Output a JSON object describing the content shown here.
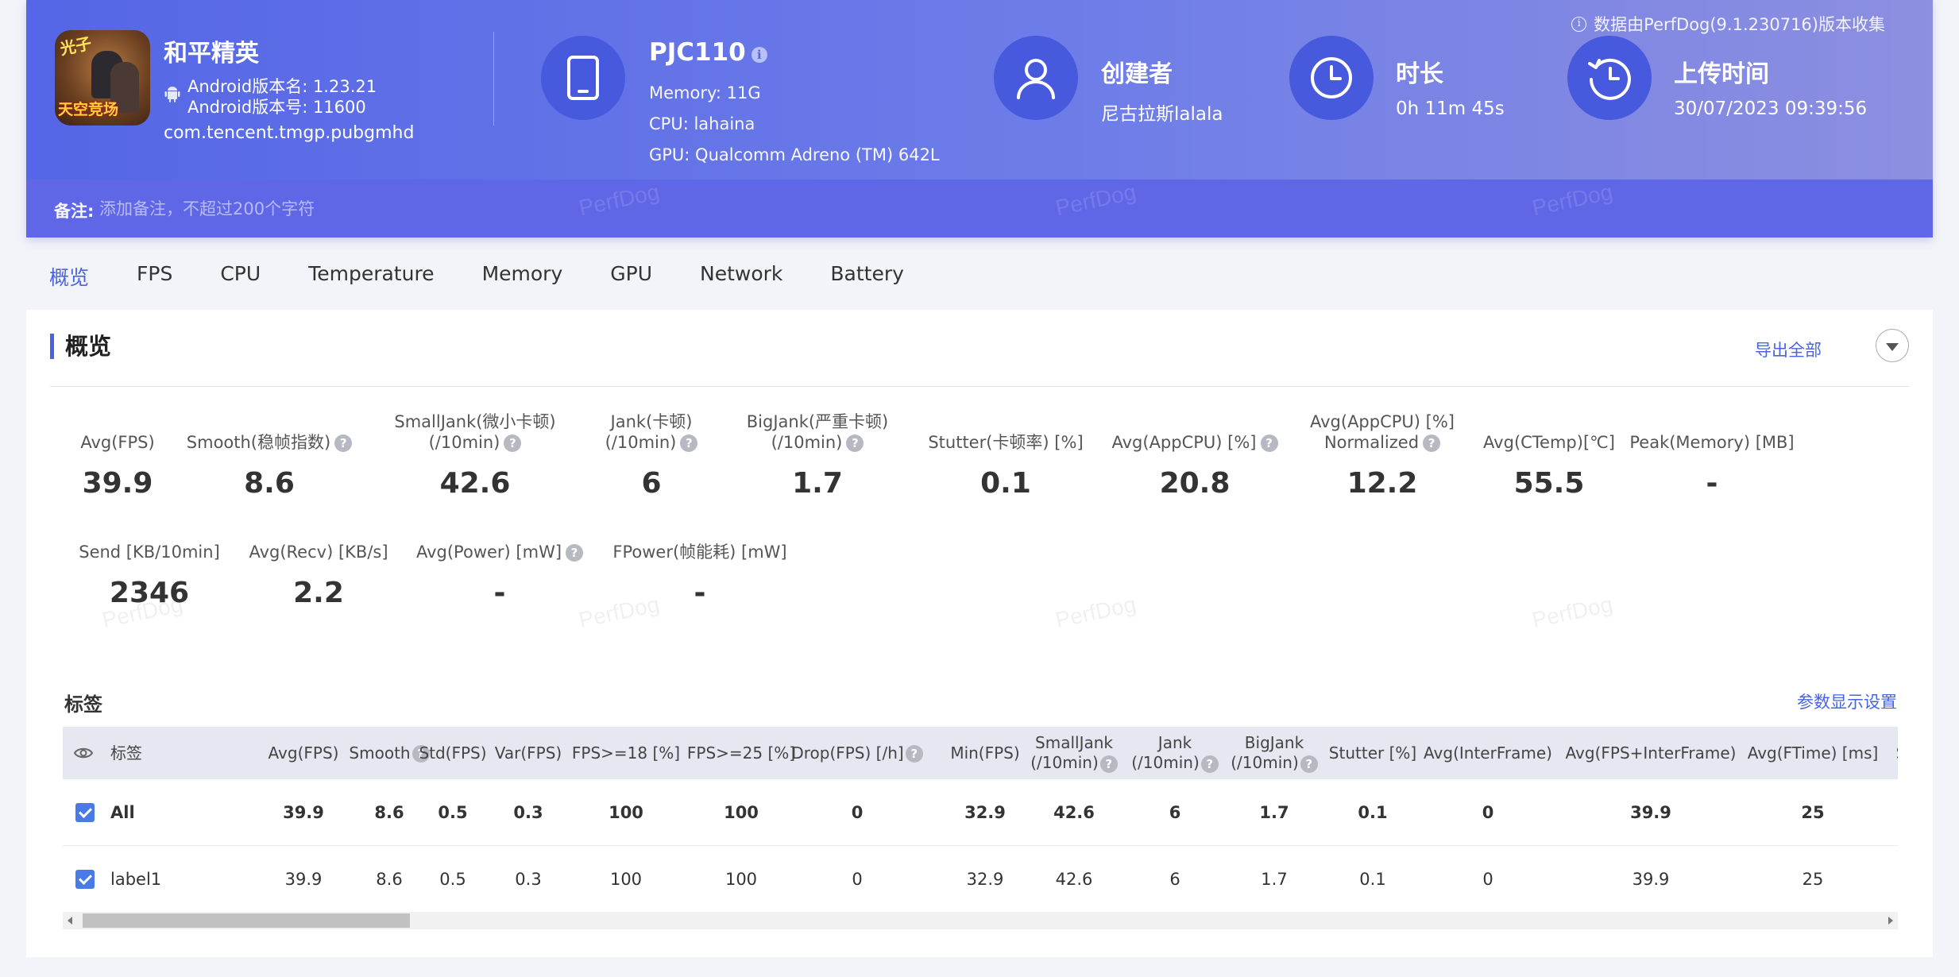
{
  "colors": {
    "accent": "#4a63e0",
    "header_start": "#5566e6",
    "header_end": "#8d8fe0",
    "checkbox": "#4a7ae6"
  },
  "app": {
    "name": "和平精英",
    "version_name": "Android版本名: 1.23.21",
    "version_code": "Android版本号: 11600",
    "package": "com.tencent.tmgp.pubgmhd",
    "icon_text_top": "光子",
    "icon_text_bottom": "天空竞场"
  },
  "device": {
    "model": "PJC110",
    "info_glyph": "i",
    "memory": "Memory: 11G",
    "cpu": "CPU: lahaina",
    "gpu": "GPU: Qualcomm Adreno (TM) 642L"
  },
  "creator": {
    "label": "创建者",
    "value": "尼古拉斯lalala"
  },
  "duration": {
    "label": "时长",
    "value": "0h 11m 45s"
  },
  "upload": {
    "label": "上传时间",
    "value": "30/07/2023 09:39:56"
  },
  "collect_note": {
    "glyph": "i",
    "text": "数据由PerfDog(9.1.230716)版本收集"
  },
  "remark": {
    "label": "备注:",
    "placeholder": "添加备注，不超过200个字符"
  },
  "watermark": "PerfDog",
  "tabs": [
    "概览",
    "FPS",
    "CPU",
    "Temperature",
    "Memory",
    "GPU",
    "Network",
    "Battery"
  ],
  "overview": {
    "title": "概览",
    "export_label": "导出全部",
    "help_glyph": "?",
    "metrics_row1": [
      {
        "label": "Avg(FPS)",
        "value": "39.9",
        "help": false
      },
      {
        "label": "Smooth(稳帧指数)",
        "value": "8.6",
        "help": true
      },
      {
        "label": "SmallJank(微小卡顿)",
        "label2": "(/10min)",
        "value": "42.6",
        "help": true
      },
      {
        "label": "Jank(卡顿)",
        "label2": "(/10min)",
        "value": "6",
        "help": true
      },
      {
        "label": "BigJank(严重卡顿)",
        "label2": "(/10min)",
        "value": "1.7",
        "help": true
      },
      {
        "label": "Stutter(卡顿率) [%]",
        "value": "0.1",
        "help": false
      },
      {
        "label": "Avg(AppCPU) [%]",
        "value": "20.8",
        "help": true
      },
      {
        "label": "Avg(AppCPU) [%]",
        "label2": "Normalized",
        "value": "12.2",
        "help": true
      },
      {
        "label": "Avg(CTemp)[℃]",
        "value": "55.5",
        "help": false
      },
      {
        "label": "Peak(Memory) [MB]",
        "value": "-",
        "help": false
      }
    ],
    "metrics_row2": [
      {
        "label": "Send [KB/10min]",
        "value": "2346",
        "help": false
      },
      {
        "label": "Avg(Recv) [KB/s]",
        "value": "2.2",
        "help": false
      },
      {
        "label": "Avg(Power) [mW]",
        "value": "-",
        "help": true
      },
      {
        "label": "FPower(帧能耗) [mW]",
        "value": "-",
        "help": false
      }
    ]
  },
  "tags": {
    "title": "标签",
    "params_label": "参数显示设置",
    "columns": [
      {
        "label": "标签"
      },
      {
        "label": "Avg(FPS)"
      },
      {
        "label": "Smooth",
        "help": true
      },
      {
        "label": "Std(FPS)"
      },
      {
        "label": "Var(FPS)"
      },
      {
        "label": "FPS>=18 [%]"
      },
      {
        "label": "FPS>=25 [%]"
      },
      {
        "label": "Drop(FPS) [/h]",
        "help": true
      },
      {
        "label": "Min(FPS)"
      },
      {
        "label": "SmallJank",
        "label2": "(/10min)",
        "help": true
      },
      {
        "label": "Jank",
        "label2": "(/10min)",
        "help": true
      },
      {
        "label": "BigJank",
        "label2": "(/10min)",
        "help": true
      },
      {
        "label": "Stutter [%]"
      },
      {
        "label": "Avg(InterFrame)"
      },
      {
        "label": "Avg(FPS+InterFrame)"
      },
      {
        "label": "Avg(FTime) [ms]"
      },
      {
        "label": "S"
      }
    ],
    "rows": [
      {
        "name": "All",
        "checked": true,
        "bold": true,
        "values": [
          "39.9",
          "8.6",
          "0.5",
          "0.3",
          "100",
          "100",
          "0",
          "32.9",
          "42.6",
          "6",
          "1.7",
          "0.1",
          "0",
          "39.9",
          "25"
        ]
      },
      {
        "name": "label1",
        "checked": true,
        "bold": false,
        "values": [
          "39.9",
          "8.6",
          "0.5",
          "0.3",
          "100",
          "100",
          "0",
          "32.9",
          "42.6",
          "6",
          "1.7",
          "0.1",
          "0",
          "39.9",
          "25"
        ]
      }
    ]
  }
}
